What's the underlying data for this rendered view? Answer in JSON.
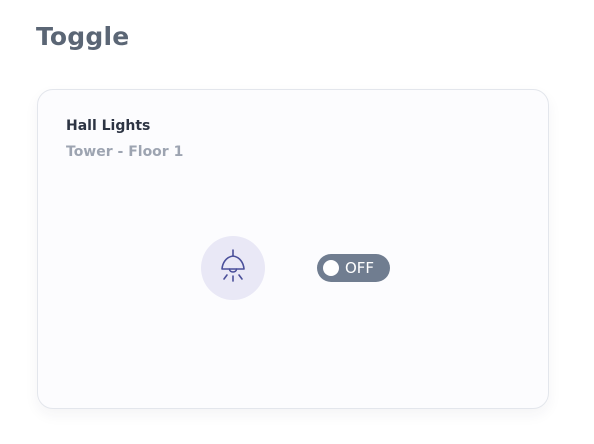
{
  "header": {
    "title": "Toggle"
  },
  "device_card": {
    "name": "Hall Lights",
    "location": "Tower - Floor 1",
    "icon": "lamp-icon",
    "toggle": {
      "state": "OFF",
      "is_on": false
    }
  },
  "colors": {
    "toggle_off": "#707d90",
    "icon_bg": "#e9e8f6",
    "icon_stroke": "#4a4f9a"
  }
}
